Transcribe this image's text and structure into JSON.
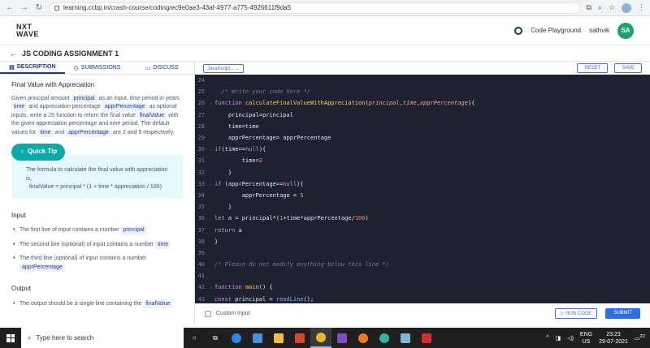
{
  "browser": {
    "url": "learning.ccbp.in/crash-course/coding/ec9e0ae3-43af-4977-a775-4926611f9da5"
  },
  "header": {
    "logo_line1": "NXT",
    "logo_line2": "WAVE",
    "playground": "Code Playground",
    "username": "sathvik",
    "avatar": "SA"
  },
  "title": {
    "text": "JS CODING ASSIGNMENT 1"
  },
  "tabs": [
    {
      "label": "DESCRIPTION"
    },
    {
      "label": "SUBMISSIONS"
    },
    {
      "label": "DISCUSS"
    }
  ],
  "desc": {
    "heading": "Final Value with Appreciation",
    "p1a": "Given principal amount",
    "c_principal": "principal",
    "p1b": "as an input, time period in years",
    "c_time": "time",
    "p1c": "and appreciation percentage",
    "c_appr": "apprPercentage",
    "p1d": "as optional inputs, write a JS function to return the final value",
    "c_final": "finalValue",
    "p1e": "with the given appreciation percentage and time period. The default values for",
    "c_time2": "time",
    "p1f": "and",
    "c_appr2": "apprPercentage",
    "p1g": "are 2 and 5 respectively.",
    "tip_label": "Quick Tip",
    "tip_text": "The formula to calculate the final value with appreciation is,",
    "tip_formula": "finalValue = principal * (1 + time * appreciation / 100)",
    "input_h": "Input",
    "in1a": "The first line of input contains a number",
    "in1c": "principal",
    "in2a": "The second line (optional) of input contains a number",
    "in2c": "time",
    "in3a": "The third line (optional) of input contains a number",
    "in3c": "apprPercentage",
    "output_h": "Output",
    "out1a": "The output should be a single line containing the",
    "out1c": "finalValue"
  },
  "toolbar": {
    "lang": "JavaScript...",
    "reset": "RESET",
    "save": "SAVE"
  },
  "bottom": {
    "custom": "Custom Input",
    "run": "RUN CODE",
    "submit": "SUBMIT"
  },
  "taskbar": {
    "search": "Type here to search",
    "lang1": "ENG",
    "lang2": "US",
    "time": "23:23",
    "date": "29-07-2021",
    "notif": "22"
  }
}
